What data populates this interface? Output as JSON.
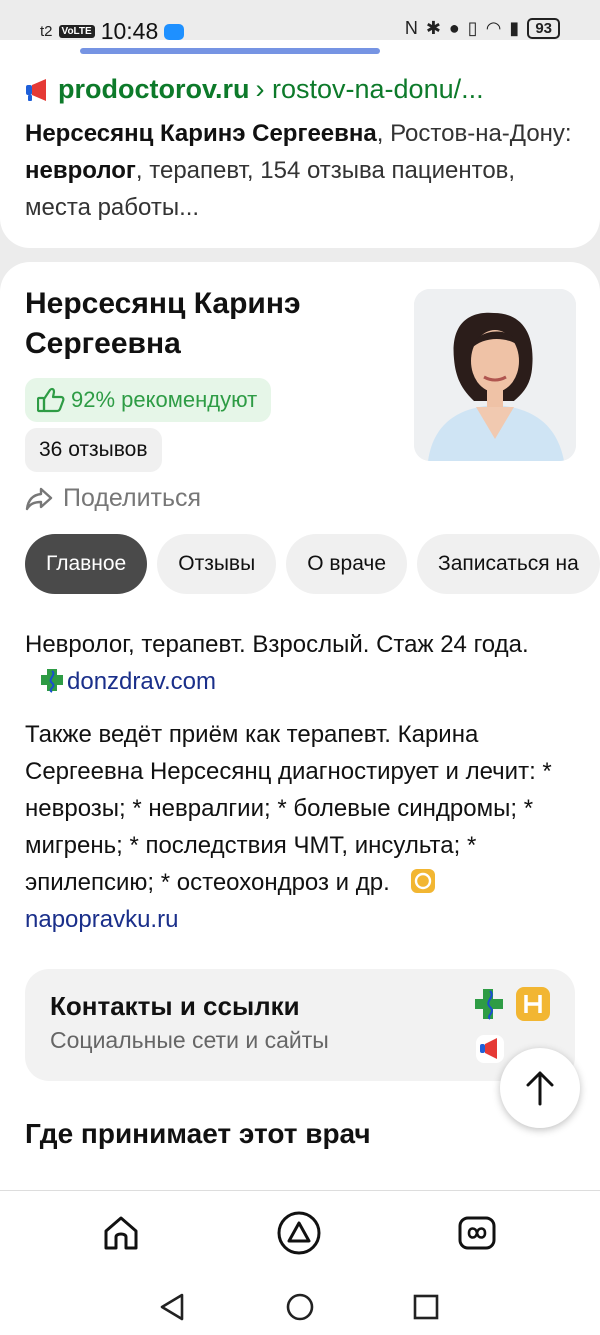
{
  "status_bar": {
    "carrier": "t2",
    "volte": "VoLTE",
    "time": "10:48",
    "battery": "93"
  },
  "search_result": {
    "domain": "prodoctorov.ru",
    "path": "› rostov-na-donu/...",
    "snippet_name": "Нерсесянц Каринэ Сергеевна",
    "snippet_city": ", Ростов-на-Дону: ",
    "snippet_spec": "невролог",
    "snippet_rest": ", терапевт, 154 отзыва пациентов, места работы..."
  },
  "doctor": {
    "name": "Нерсесянц Каринэ Сергеевна",
    "recommend": "92% рекомендуют",
    "reviews": "36 отзывов",
    "share": "Поделиться"
  },
  "tabs": [
    {
      "label": "Главное",
      "active": true
    },
    {
      "label": "Отзывы",
      "active": false
    },
    {
      "label": "О враче",
      "active": false
    },
    {
      "label": "Записаться на",
      "active": false
    }
  ],
  "description": {
    "short": "Невролог, терапевт. Взрослый. Стаж 24 года.",
    "short_source": "donzdrav.com",
    "long": "Также ведёт приём как терапевт. Карина Сергеевна Нерсесянц диагностирует и лечит: * неврозы; * невралгии; * болевые синдромы; * мигрень; * последствия ЧМТ, инсульта; * эпилепсию; * остеохондроз и др.",
    "long_source": "napopravku.ru"
  },
  "contacts": {
    "title": "Контакты и ссылки",
    "subtitle": "Социальные сети и сайты"
  },
  "where": {
    "title": "Где принимает этот врач"
  },
  "colors": {
    "green_domain": "#0d7a2a",
    "recommend_bg": "#e6f6e8",
    "recommend_text": "#2e9c45",
    "active_tab": "#4a4a4a",
    "link": "#1a2f8a"
  }
}
